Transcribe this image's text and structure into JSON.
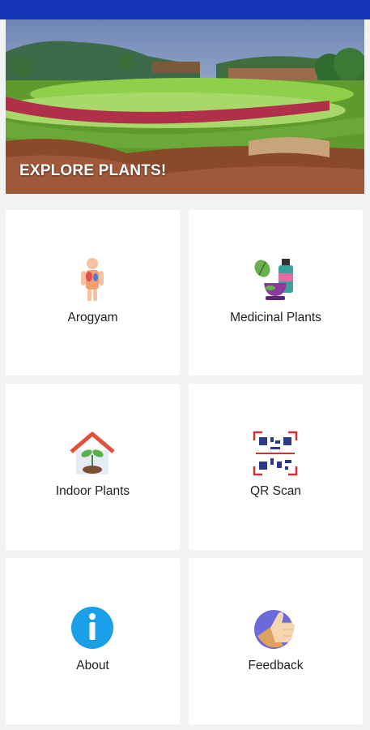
{
  "colors": {
    "status_bar": "#1433b8",
    "background": "#f3f3f3",
    "card": "#ffffff",
    "text": "#222222"
  },
  "banner": {
    "title": "EXPLORE PLANTS!"
  },
  "menu": [
    {
      "label": "Arogyam",
      "icon": "human-anatomy-icon"
    },
    {
      "label": "Medicinal Plants",
      "icon": "medicinal-plants-icon"
    },
    {
      "label": "Indoor Plants",
      "icon": "house-plant-icon"
    },
    {
      "label": "QR Scan",
      "icon": "qr-code-icon"
    },
    {
      "label": "About",
      "icon": "info-icon"
    },
    {
      "label": "Feedback",
      "icon": "thumbs-up-icon"
    }
  ]
}
